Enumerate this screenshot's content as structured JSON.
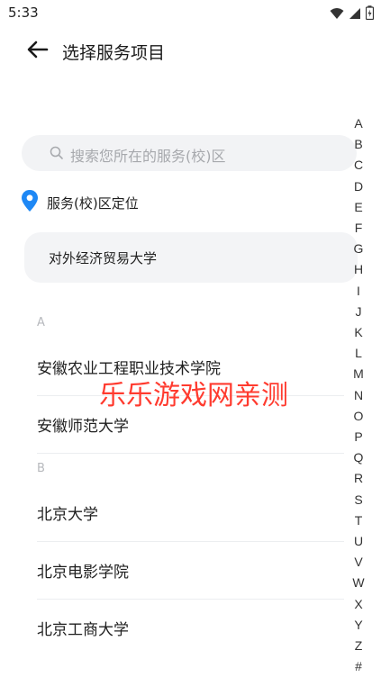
{
  "status_bar": {
    "time": "5:33"
  },
  "header": {
    "title": "选择服务项目"
  },
  "search": {
    "placeholder": "搜索您所在的服务(校)区"
  },
  "locate": {
    "label": "服务(校)区定位"
  },
  "current_school": {
    "name": "对外经济贸易大学"
  },
  "sections": [
    {
      "letter": "A",
      "schools": [
        "安徽农业工程职业技术学院",
        "安徽师范大学"
      ]
    },
    {
      "letter": "B",
      "schools": [
        "北京大学",
        "北京电影学院",
        "北京工商大学"
      ]
    }
  ],
  "index_letters": [
    "A",
    "B",
    "C",
    "D",
    "E",
    "F",
    "G",
    "H",
    "I",
    "J",
    "K",
    "L",
    "M",
    "N",
    "O",
    "P",
    "Q",
    "R",
    "S",
    "T",
    "U",
    "V",
    "W",
    "X",
    "Y",
    "Z",
    "#"
  ],
  "watermark": "乐乐游戏网亲测",
  "colors": {
    "accent": "#1e88f5",
    "watermark": "#ff3b2f",
    "search_bg": "#f2f3f5"
  }
}
